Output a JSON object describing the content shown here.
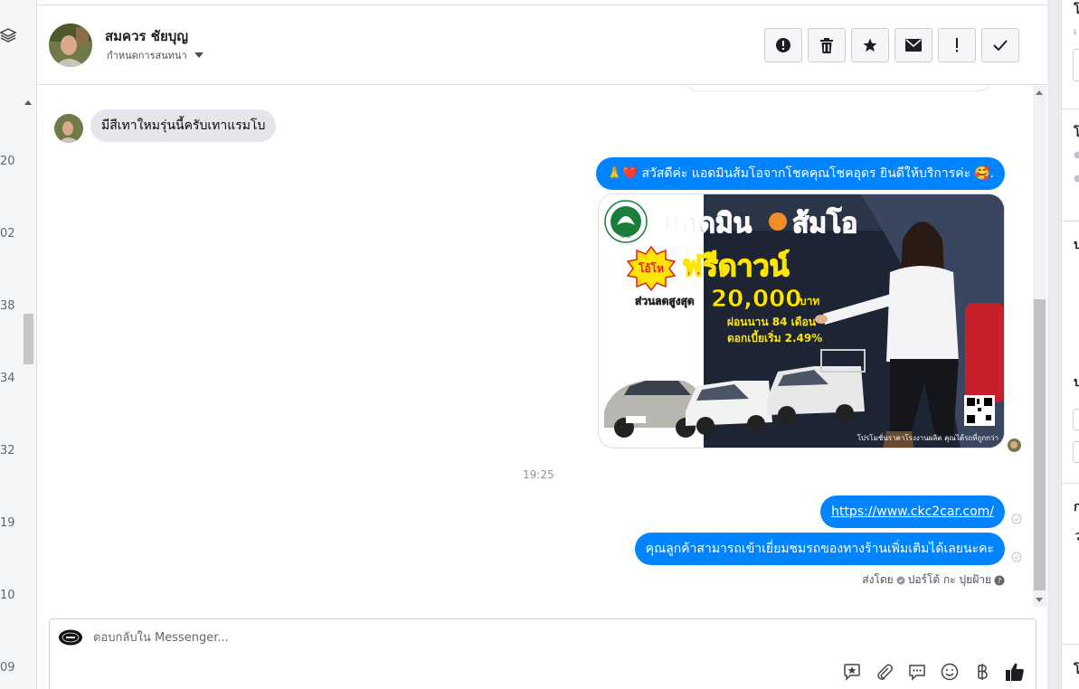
{
  "left_list": {
    "numbers": [
      "20",
      "02",
      "38",
      "34",
      "32",
      "19",
      "10",
      "09"
    ]
  },
  "header": {
    "contact_name": "สมควร ชัยบุญ",
    "assign_label": "กำหนดการสนทนา",
    "actions": [
      "report-icon",
      "trash-icon",
      "star-icon",
      "envelope-icon",
      "exclamation-icon",
      "check-icon"
    ]
  },
  "messages": {
    "incoming_text": "มีสีเทาใหมรุ่นนี้ครับเทาแรมโบ",
    "greeting": {
      "emoji_left": "🙏❤️",
      "text": "สวัสดีค่ะ แอดมินส้มโอจากโชคคุณโชคอุดร ยินดีให้บริการค่ะ",
      "emoji_right": "🥰."
    },
    "promo": {
      "headline": "แอดมิน",
      "headline2": "ส้มโอ",
      "badge": "โอ้โห",
      "free_down": "ฟรีดาวน์",
      "discount_label": "ส่วนลดสูงสุด",
      "discount_value": "20,000",
      "discount_unit": "บาท",
      "installment": "ผ่อนนาน 84 เดือน",
      "interest": "ดอกเบี้ยเริ่ม 2.49%",
      "footer": "โปรโมชั่นราคาโรงงานผลิต คุณได้รถที่ถูกกว่า",
      "logo_text": "CKC"
    },
    "timestamp": "19:25",
    "link": "https://www.ckc2car.com/",
    "followup": "คุณลูกค้าสามารถเข้าเยี่ยมชมรถของทางร้านเพิ่มเติมได้เลยนะคะ",
    "sent_by_label": "ส่งโดย",
    "sent_by_name": "ปอร์โต้ กะ ปุยฝ้าย"
  },
  "composer": {
    "placeholder": "ตอบกลับใน Messenger...",
    "tools": [
      "saved-reply-icon",
      "paperclip-icon",
      "chat-bubbles-icon",
      "emoji-icon",
      "baht-icon",
      "thumbs-up-icon"
    ]
  },
  "right_col": {
    "glyphs": [
      "โ",
      "ป",
      "ป",
      "ก",
      "ว",
      "โ"
    ]
  },
  "colors": {
    "accent": "#0084ff",
    "incoming_bubble": "#e4e6eb",
    "promo_red": "#e31e24",
    "promo_yellow": "#ffe600"
  }
}
